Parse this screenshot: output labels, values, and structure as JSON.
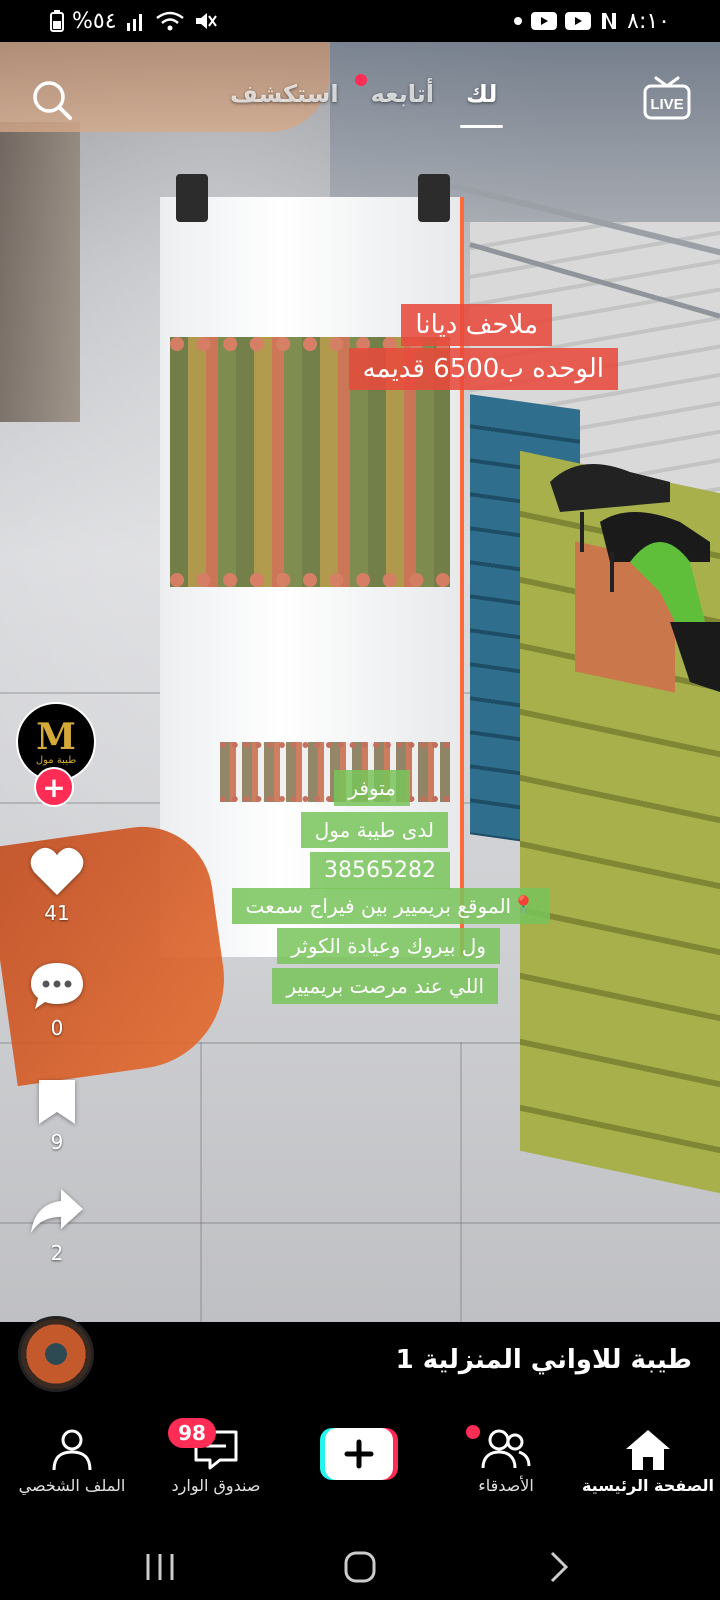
{
  "status_bar": {
    "time": "٨:١٠",
    "battery": "%٥٤",
    "icons": [
      "youtube-icon",
      "youtube-icon",
      "netflix-icon",
      "dot-icon",
      "mute-icon",
      "wifi-icon",
      "signal-icon",
      "battery-icon"
    ]
  },
  "top_nav": {
    "tabs": [
      {
        "label": "لك",
        "active": true
      },
      {
        "label": "أتابعه",
        "active": false,
        "dot": true
      },
      {
        "label": "استكشف",
        "active": false
      }
    ],
    "live_label": "LIVE"
  },
  "captions": {
    "line1": "ملاحف ديانا",
    "line2": "الوحده ب6500 قديمه",
    "line3": "متوفر",
    "line4": "لدى طيبة مول",
    "line5": "38565282",
    "line6": "📍الموقع بريميير بين فيراج سمعت",
    "line7": "ول بيروك وعيادة الكوثر",
    "line8": "اللي عند مرصت بريميير"
  },
  "profile": {
    "logo_text": "M",
    "logo_sub": "طيبة مول",
    "follow_symbol": "+"
  },
  "actions": {
    "likes": "41",
    "comments": "0",
    "saves": "9",
    "shares": "2"
  },
  "video_info": {
    "title": "طيبة للاواني المنزلية 1"
  },
  "bottom_nav": {
    "items": [
      {
        "label": "الصفحة الرئيسية",
        "active": true
      },
      {
        "label": "الأصدقاء"
      },
      {
        "label": "صندوق الوارد"
      },
      {
        "label": "الملف الشخصي"
      }
    ],
    "inbox_badge": "98",
    "create_symbol": "+"
  },
  "colors": {
    "accent": "#ff2c55",
    "caption_red": "#e84a3c",
    "caption_green": "#78c45a"
  }
}
